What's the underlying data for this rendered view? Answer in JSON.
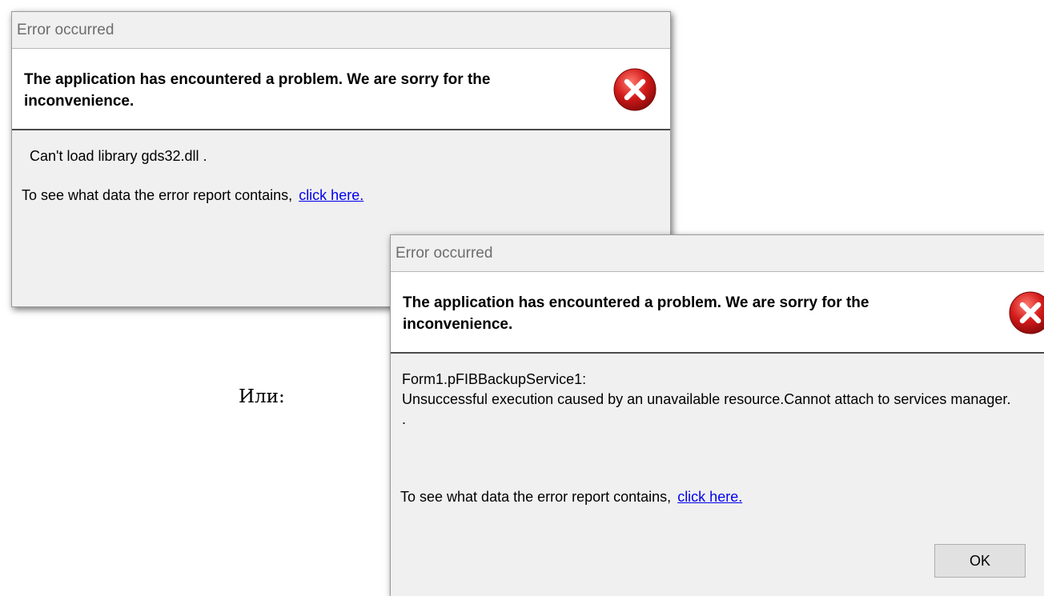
{
  "dialog1": {
    "title": "Error occurred",
    "header_text": "The application has encountered a problem. We are sorry for the inconvenience.",
    "icon": "error-icon",
    "message": "Can't load library gds32.dll .",
    "report_text": "To see what data the error report contains,",
    "report_link": "click here."
  },
  "separator_label": "Или:",
  "dialog2": {
    "title": "Error occurred",
    "header_text": "The application has encountered a problem. We are sorry for the inconvenience.",
    "icon": "error-icon",
    "message": "Form1.pFIBBackupService1:\nUnsuccessful execution caused by an unavailable resource.Cannot attach to services manager.\n.",
    "report_text": "To see what data the error report contains,",
    "report_link": "click here.",
    "ok_label": "OK"
  },
  "colors": {
    "dialog_bg": "#f0f0f0",
    "header_bg": "#ffffff",
    "link": "#0000ee",
    "icon_red": "#d21a1a"
  }
}
